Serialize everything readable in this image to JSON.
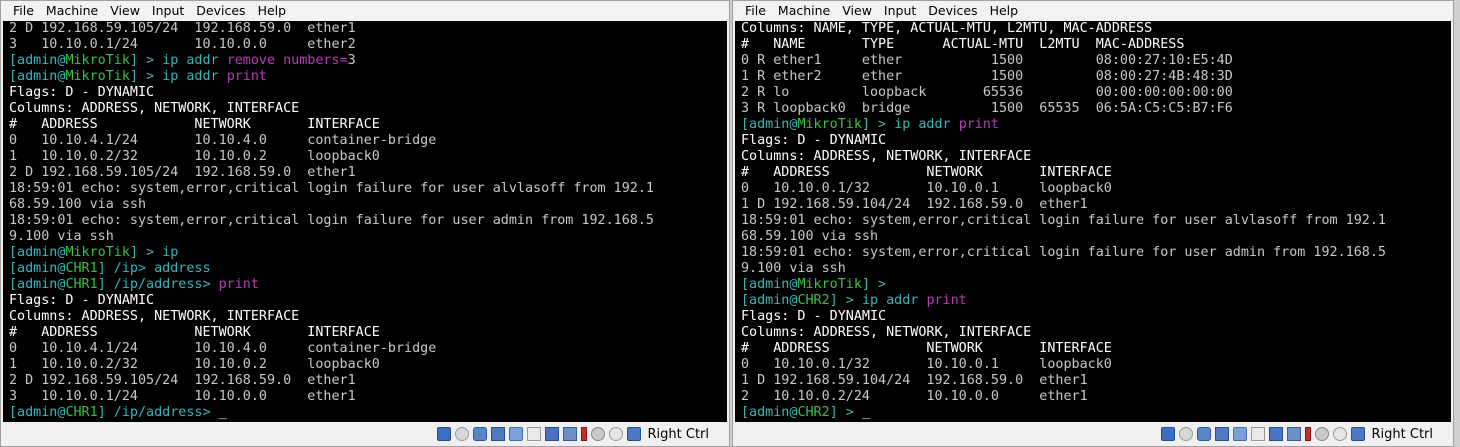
{
  "left_vm": {
    "menu": [
      "File",
      "Machine",
      "View",
      "Input",
      "Devices",
      "Help"
    ],
    "terminal_lines": [
      [
        {
          "t": "2 D 192.168.59.105/24  192.168.59.0  ether1",
          "c": "default"
        }
      ],
      [
        {
          "t": "3   10.10.0.1/24       10.10.0.0     ether2",
          "c": "default"
        }
      ],
      [
        {
          "t": "[admin@",
          "c": "cyan"
        },
        {
          "t": "MikroTik",
          "c": "green"
        },
        {
          "t": "] > ",
          "c": "cyan"
        },
        {
          "t": "ip addr ",
          "c": "cyan"
        },
        {
          "t": "remove numbers=",
          "c": "magenta"
        },
        {
          "t": "3",
          "c": "default"
        }
      ],
      [
        {
          "t": "[admin@",
          "c": "cyan"
        },
        {
          "t": "MikroTik",
          "c": "green"
        },
        {
          "t": "] > ",
          "c": "cyan"
        },
        {
          "t": "ip addr ",
          "c": "cyan"
        },
        {
          "t": "print",
          "c": "magenta"
        }
      ],
      [
        {
          "t": "Flags: D - DYNAMIC",
          "c": "white"
        }
      ],
      [
        {
          "t": "Columns: ADDRESS, NETWORK, INTERFACE",
          "c": "white"
        }
      ],
      [
        {
          "t": "#   ADDRESS            NETWORK       INTERFACE",
          "c": "white"
        }
      ],
      [
        {
          "t": "0   10.10.4.1/24       10.10.4.0     container-bridge",
          "c": "default"
        }
      ],
      [
        {
          "t": "1   10.10.0.2/32       10.10.0.2     loopback0",
          "c": "default"
        }
      ],
      [
        {
          "t": "2 D 192.168.59.105/24  192.168.59.0  ether1",
          "c": "default"
        }
      ],
      [
        {
          "t": "18:59:01 echo: system,error,critical login failure for user alvlasoff from 192.1",
          "c": "default"
        }
      ],
      [
        {
          "t": "68.59.100 via ssh",
          "c": "default"
        }
      ],
      [
        {
          "t": "18:59:01 echo: system,error,critical login failure for user admin from 192.168.5",
          "c": "default"
        }
      ],
      [
        {
          "t": "9.100 via ssh",
          "c": "default"
        }
      ],
      [
        {
          "t": "[admin@",
          "c": "cyan"
        },
        {
          "t": "MikroTik",
          "c": "green"
        },
        {
          "t": "] > ",
          "c": "cyan"
        },
        {
          "t": "ip",
          "c": "cyan"
        }
      ],
      [
        {
          "t": "[admin@",
          "c": "cyan"
        },
        {
          "t": "CHR1",
          "c": "green"
        },
        {
          "t": "] /ip> ",
          "c": "cyan"
        },
        {
          "t": "address",
          "c": "cyan"
        }
      ],
      [
        {
          "t": "[admin@",
          "c": "cyan"
        },
        {
          "t": "CHR1",
          "c": "green"
        },
        {
          "t": "] /ip/address> ",
          "c": "cyan"
        },
        {
          "t": "print",
          "c": "magenta"
        }
      ],
      [
        {
          "t": "Flags: D - DYNAMIC",
          "c": "white"
        }
      ],
      [
        {
          "t": "Columns: ADDRESS, NETWORK, INTERFACE",
          "c": "white"
        }
      ],
      [
        {
          "t": "#   ADDRESS            NETWORK       INTERFACE",
          "c": "white"
        }
      ],
      [
        {
          "t": "0   10.10.4.1/24       10.10.4.0     container-bridge",
          "c": "default"
        }
      ],
      [
        {
          "t": "1   10.10.0.2/32       10.10.0.2     loopback0",
          "c": "default"
        }
      ],
      [
        {
          "t": "2 D 192.168.59.105/24  192.168.59.0  ether1",
          "c": "default"
        }
      ],
      [
        {
          "t": "3   10.10.0.1/24       10.10.0.0     ether1",
          "c": "default"
        }
      ],
      [
        {
          "t": "[admin@",
          "c": "cyan"
        },
        {
          "t": "CHR1",
          "c": "green"
        },
        {
          "t": "] /ip/address> ",
          "c": "cyan"
        },
        {
          "t": "_",
          "c": "white"
        }
      ]
    ],
    "status": {
      "host_key": "Right Ctrl"
    }
  },
  "right_vm": {
    "menu": [
      "File",
      "Machine",
      "View",
      "Input",
      "Devices",
      "Help"
    ],
    "terminal_lines": [
      [
        {
          "t": "Columns: NAME, TYPE, ACTUAL-MTU, L2MTU, MAC-ADDRESS",
          "c": "white"
        }
      ],
      [
        {
          "t": "#   NAME       TYPE      ACTUAL-MTU  L2MTU  MAC-ADDRESS",
          "c": "white"
        }
      ],
      [
        {
          "t": "0 R ether1     ether           1500         08:00:27:10:E5:4D",
          "c": "default"
        }
      ],
      [
        {
          "t": "1 R ether2     ether           1500         08:00:27:4B:48:3D",
          "c": "default"
        }
      ],
      [
        {
          "t": "2 R lo         loopback       65536         00:00:00:00:00:00",
          "c": "default"
        }
      ],
      [
        {
          "t": "3 R loopback0  bridge          1500  65535  06:5A:C5:C5:B7:F6",
          "c": "default"
        }
      ],
      [
        {
          "t": "[admin@",
          "c": "cyan"
        },
        {
          "t": "MikroTik",
          "c": "green"
        },
        {
          "t": "] > ",
          "c": "cyan"
        },
        {
          "t": "ip addr ",
          "c": "cyan"
        },
        {
          "t": "print",
          "c": "magenta"
        }
      ],
      [
        {
          "t": "Flags: D - DYNAMIC",
          "c": "white"
        }
      ],
      [
        {
          "t": "Columns: ADDRESS, NETWORK, INTERFACE",
          "c": "white"
        }
      ],
      [
        {
          "t": "#   ADDRESS            NETWORK       INTERFACE",
          "c": "white"
        }
      ],
      [
        {
          "t": "0   10.10.0.1/32       10.10.0.1     loopback0",
          "c": "default"
        }
      ],
      [
        {
          "t": "1 D 192.168.59.104/24  192.168.59.0  ether1",
          "c": "default"
        }
      ],
      [
        {
          "t": "18:59:01 echo: system,error,critical login failure for user alvlasoff from 192.1",
          "c": "default"
        }
      ],
      [
        {
          "t": "68.59.100 via ssh",
          "c": "default"
        }
      ],
      [
        {
          "t": "18:59:01 echo: system,error,critical login failure for user admin from 192.168.5",
          "c": "default"
        }
      ],
      [
        {
          "t": "9.100 via ssh",
          "c": "default"
        }
      ],
      [
        {
          "t": "[admin@",
          "c": "cyan"
        },
        {
          "t": "MikroTik",
          "c": "green"
        },
        {
          "t": "] >",
          "c": "cyan"
        }
      ],
      [
        {
          "t": "[admin@",
          "c": "cyan"
        },
        {
          "t": "CHR2",
          "c": "green"
        },
        {
          "t": "] > ",
          "c": "cyan"
        },
        {
          "t": "ip addr ",
          "c": "cyan"
        },
        {
          "t": "print",
          "c": "magenta"
        }
      ],
      [
        {
          "t": "Flags: D - DYNAMIC",
          "c": "white"
        }
      ],
      [
        {
          "t": "Columns: ADDRESS, NETWORK, INTERFACE",
          "c": "white"
        }
      ],
      [
        {
          "t": "#   ADDRESS            NETWORK       INTERFACE",
          "c": "white"
        }
      ],
      [
        {
          "t": "0   10.10.0.1/32       10.10.0.1     loopback0",
          "c": "default"
        }
      ],
      [
        {
          "t": "1 D 192.168.59.104/24  192.168.59.0  ether1",
          "c": "default"
        }
      ],
      [
        {
          "t": "2   10.10.0.2/24       10.10.0.0     ether1",
          "c": "default"
        }
      ],
      [
        {
          "t": "[admin@",
          "c": "cyan"
        },
        {
          "t": "CHR2",
          "c": "green"
        },
        {
          "t": "] > ",
          "c": "cyan"
        },
        {
          "t": "_",
          "c": "white"
        }
      ]
    ],
    "status": {
      "host_key": "Right Ctrl"
    }
  },
  "status_icons": [
    "hard-disk-icon",
    "optical-drive-icon",
    "audio-icon",
    "network-icon",
    "usb-icon",
    "shared-folders-icon",
    "display-icon",
    "video-capture-icon",
    "recording-icon",
    "cpu-icon",
    "mouse-integration-icon",
    "keyboard-icon"
  ],
  "colors": {
    "terminal_bg": "#000000",
    "text_default": "#c8c8c8",
    "prompt_cyan": "#3ab5b5",
    "hostname_green": "#3fbf3f",
    "keyword_magenta": "#b040b0",
    "header_white": "#ffffff"
  }
}
